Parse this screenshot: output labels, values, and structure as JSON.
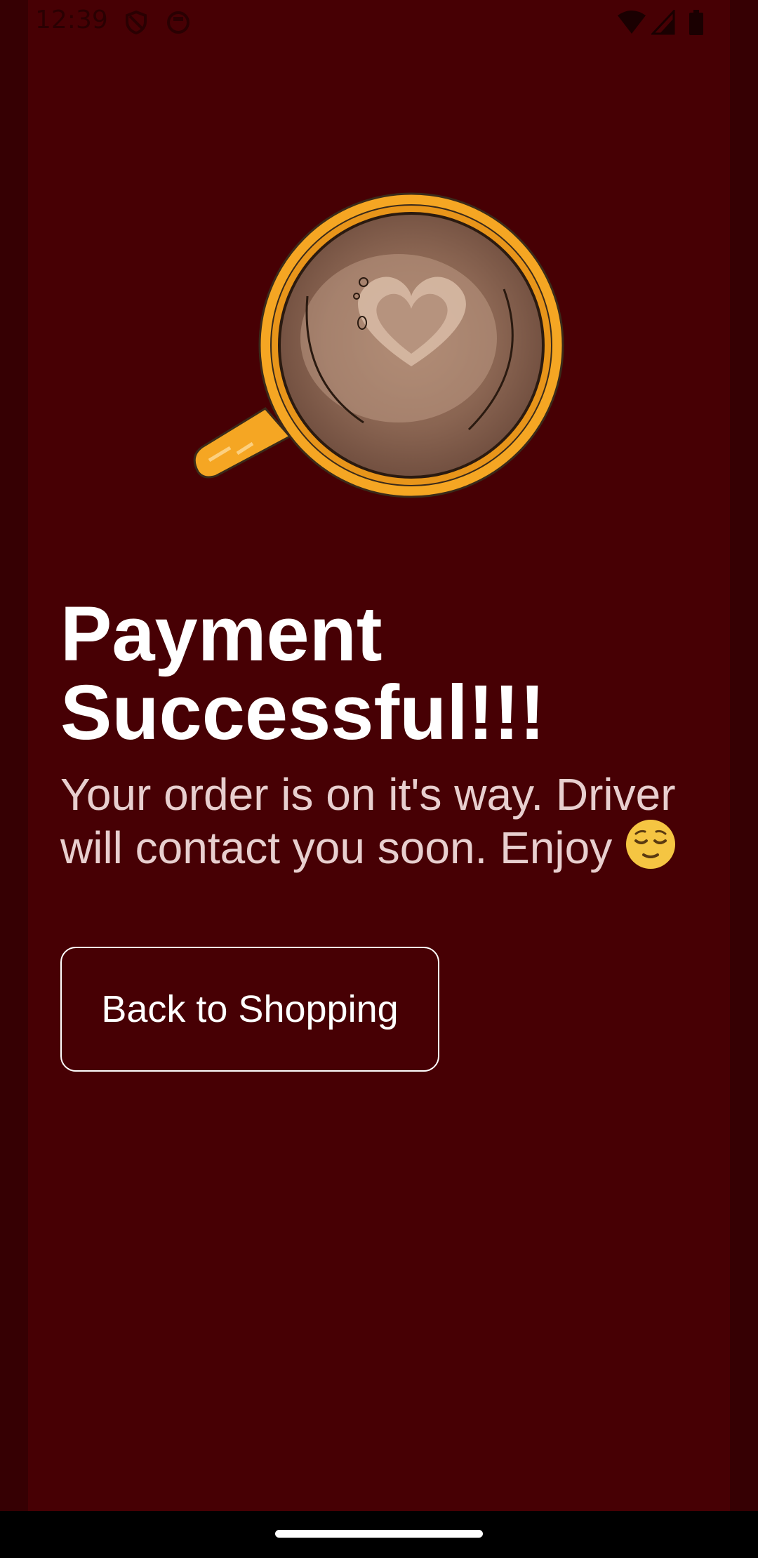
{
  "status_bar": {
    "time": "12:39",
    "icons": [
      "shield-icon",
      "circle-app-icon",
      "wifi-icon",
      "signal-icon",
      "battery-icon"
    ]
  },
  "hero": {
    "image": "coffee-cup-latte-art-heart"
  },
  "content": {
    "title": " Payment\nSuccessful!!!",
    "message": "Your order is on it's way. Driver will contact you soon. Enjoy ",
    "emoji": "relieved-face-emoji"
  },
  "actions": {
    "back_button_label": "Back to Shopping"
  },
  "colors": {
    "background": "#470004",
    "accent_cup": "#f5a623",
    "text_primary": "#ffffff",
    "text_secondary": "#e8cfcf"
  }
}
